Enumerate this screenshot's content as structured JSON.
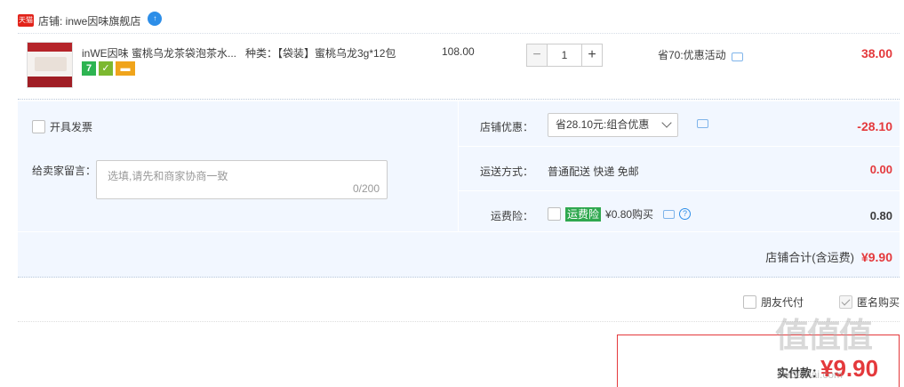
{
  "shop": {
    "name": "店铺: inwe因味旗舰店",
    "badge": "天猫",
    "ww": "↑"
  },
  "item": {
    "title": "inWE因味 蜜桃乌龙茶袋泡茶水...",
    "sku": "种类：【袋装】蜜桃乌龙3g*12包",
    "unit_price": "108.00",
    "quantity": "1",
    "minus": "−",
    "plus": "+",
    "promo": "省70:优惠活动",
    "total": "38.00",
    "tags": {
      "seven": "7",
      "guard": "✓",
      "card": "▬"
    }
  },
  "invoice": {
    "label": "开具发票"
  },
  "message": {
    "label": "给卖家留言：",
    "placeholder": "选填,请先和商家协商一致",
    "counter": "0/200"
  },
  "shop_discount": {
    "label": "店铺优惠：",
    "selected": "省28.10元:组合优惠",
    "amount": "-28.10"
  },
  "shipping": {
    "label": "运送方式：",
    "value": "普通配送 快递 免邮",
    "amount": "0.00"
  },
  "insurance": {
    "label": "运费险：",
    "badge": "运费险",
    "price": "¥0.80购买",
    "help": "?",
    "amount": "0.80"
  },
  "shop_total": {
    "label": "店铺合计(含运费)",
    "amount": "¥9.90"
  },
  "options": {
    "friend_pay": "朋友代付",
    "anonymous": "匿名购买"
  },
  "payment": {
    "label": "实付款：",
    "amount": "¥9.90"
  },
  "watermark": {
    "logo": "值值值",
    "url": "zhidemai.com"
  },
  "colors": {
    "price_red": "#e4393c",
    "panel_bg": "#f2f7ff",
    "tmall_red": "#e2231a"
  }
}
